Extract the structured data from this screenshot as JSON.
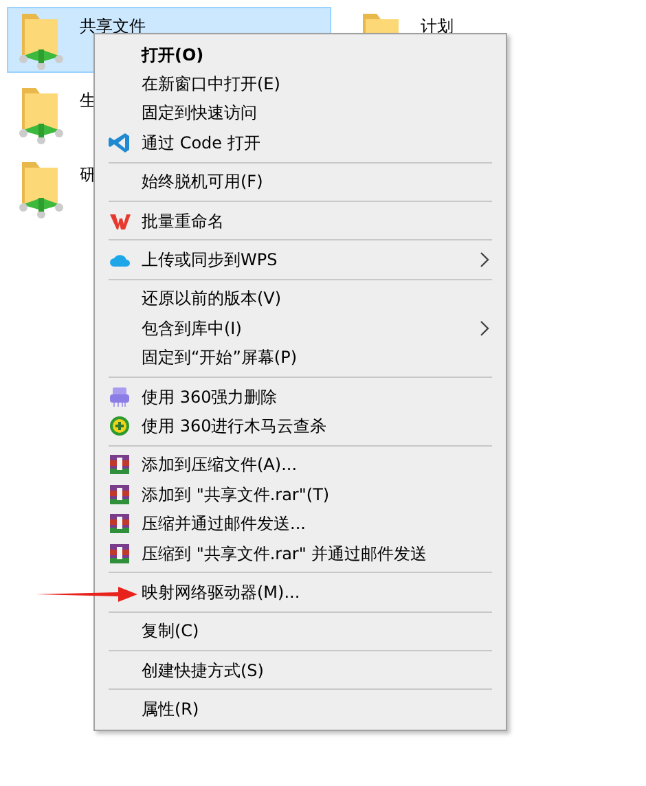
{
  "folders": [
    {
      "name": "共享文件",
      "selected": true
    },
    {
      "name": "生",
      "selected": false
    },
    {
      "name": "研",
      "selected": false
    }
  ],
  "folders_right": [
    {
      "name": "计划",
      "selected": false
    }
  ],
  "context_menu": [
    {
      "kind": "plain",
      "label": "打开(O)",
      "bold": true
    },
    {
      "kind": "plain",
      "label": "在新窗口中打开(E)"
    },
    {
      "kind": "plain",
      "label": "固定到快速访问"
    },
    {
      "kind": "code",
      "label": "通过 Code 打开"
    },
    {
      "kind": "separator"
    },
    {
      "kind": "plain",
      "label": "始终脱机可用(F)"
    },
    {
      "kind": "separator"
    },
    {
      "kind": "wps",
      "label": "批量重命名"
    },
    {
      "kind": "separator"
    },
    {
      "kind": "cloud",
      "label": "上传或同步到WPS",
      "submenu": true
    },
    {
      "kind": "separator"
    },
    {
      "kind": "plain",
      "label": "还原以前的版本(V)"
    },
    {
      "kind": "plain",
      "label": "包含到库中(I)",
      "submenu": true
    },
    {
      "kind": "plain",
      "label": "固定到“开始”屏幕(P)"
    },
    {
      "kind": "separator"
    },
    {
      "kind": "shredder",
      "label": "使用 360强力删除"
    },
    {
      "kind": "shield",
      "label": "使用 360进行木马云查杀"
    },
    {
      "kind": "separator"
    },
    {
      "kind": "archive",
      "label": "添加到压缩文件(A)..."
    },
    {
      "kind": "archive",
      "label": "添加到 \"共享文件.rar\"(T)"
    },
    {
      "kind": "archive",
      "label": "压缩并通过邮件发送..."
    },
    {
      "kind": "archive",
      "label": "压缩到 \"共享文件.rar\" 并通过邮件发送"
    },
    {
      "kind": "separator"
    },
    {
      "kind": "plain",
      "label": "映射网络驱动器(M)...",
      "pointed": true
    },
    {
      "kind": "separator"
    },
    {
      "kind": "plain",
      "label": "复制(C)"
    },
    {
      "kind": "separator"
    },
    {
      "kind": "plain",
      "label": "创建快捷方式(S)"
    },
    {
      "kind": "separator"
    },
    {
      "kind": "plain",
      "label": "属性(R)"
    }
  ]
}
